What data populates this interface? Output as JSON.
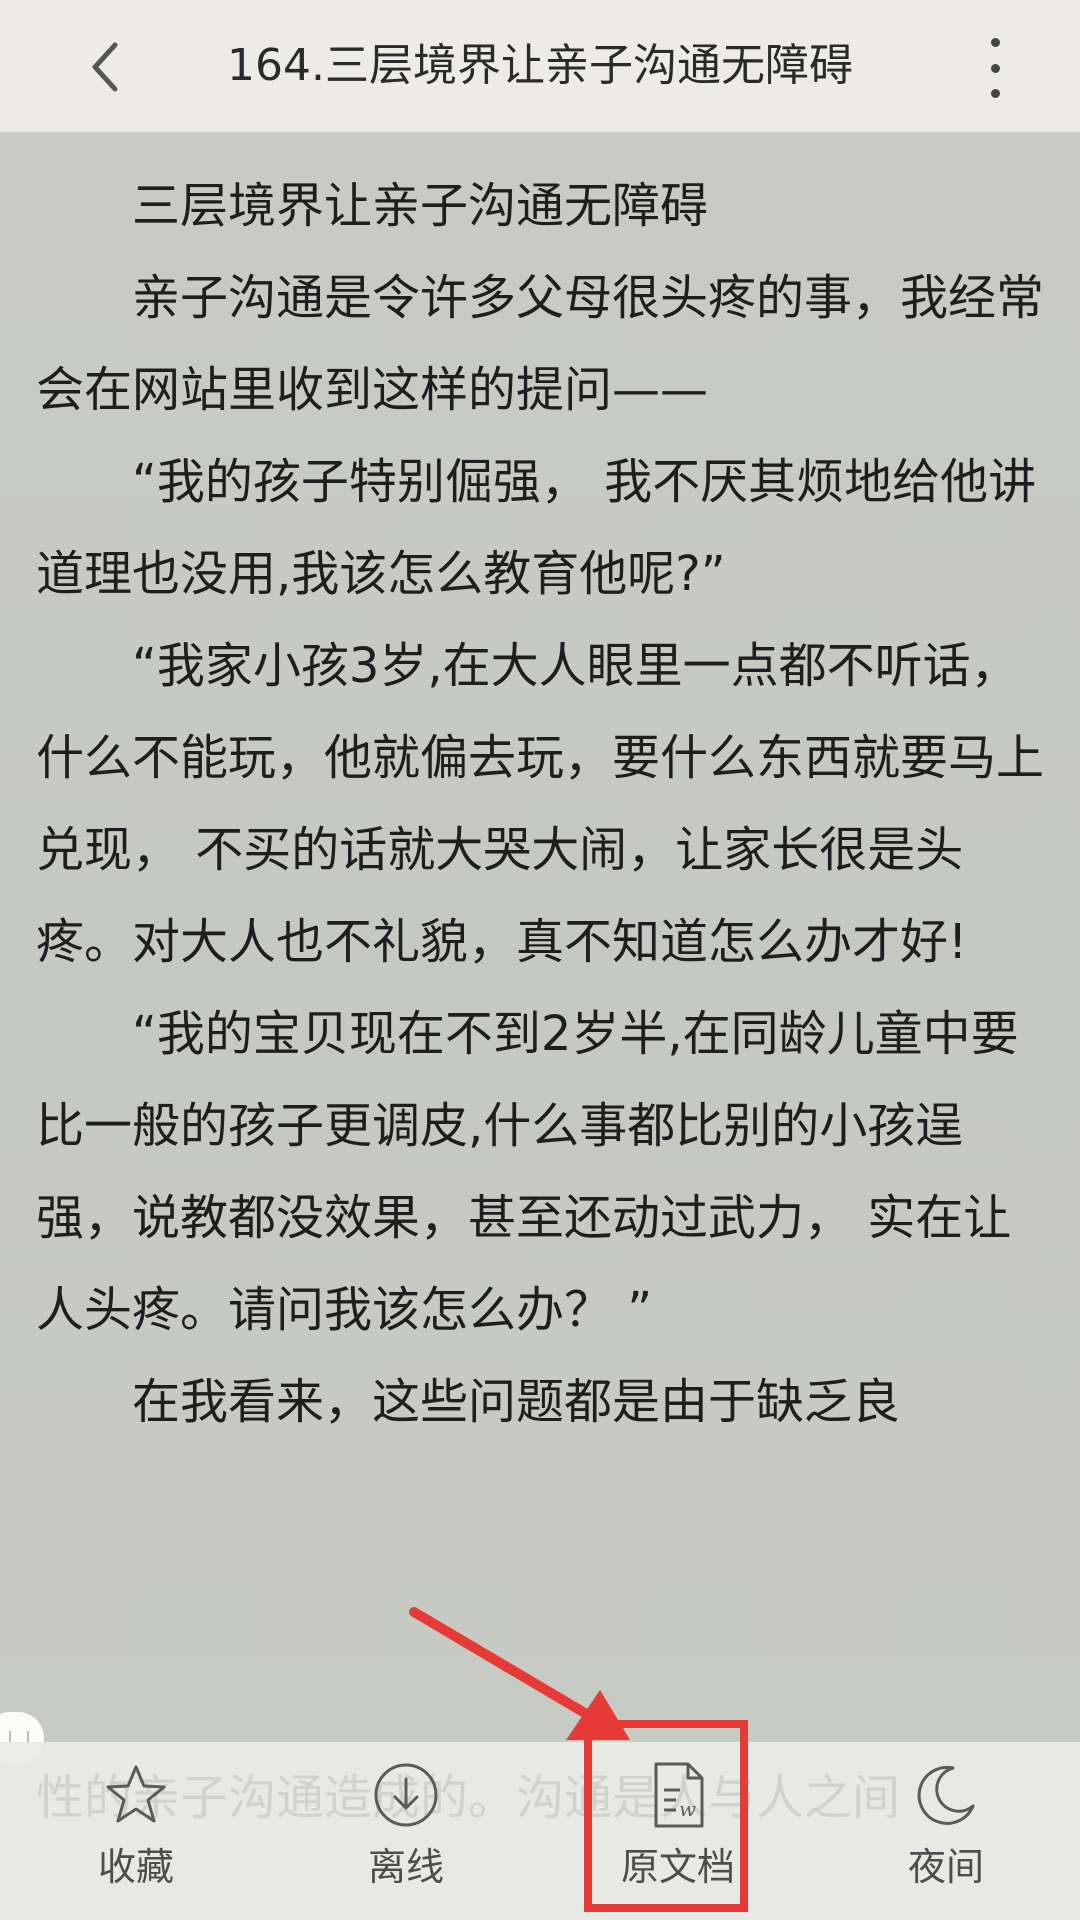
{
  "header": {
    "title": "164.三层境界让亲子沟通无障碍",
    "back_icon": "chevron-left-icon",
    "more_icon": "more-vertical-icon"
  },
  "article": {
    "heading": "三层境界让亲子沟通无障碍",
    "paragraphs": [
      "亲子沟通是令许多父母很头疼的事，我经常会在网站里收到这样的提问——",
      "“我的孩子特别倔强， 我不厌其烦地给他讲道理也没用,我该怎么教育他呢?”",
      "“我家小孩3岁,在大人眼里一点都不听话，什么不能玩，他就偏去玩，要什么东西就要马上兑现， 不买的话就大哭大闹，让家长很是头疼。对大人也不礼貌，真不知道怎么办才好!",
      "“我的宝贝现在不到2岁半,在同龄儿童中要比一般的孩子更调皮,什么事都比别的小孩逞强，说教都没效果，甚至还动过武力， 实在让人头疼。请问我该怎么办？ ”",
      "在我看来，这些问题都是由于缺乏良"
    ],
    "ghost_text": "性的亲子沟通造成的。沟通是人与人之间"
  },
  "bottom_bar": {
    "tabs": [
      {
        "label": "收藏",
        "icon": "star-icon"
      },
      {
        "label": "离线",
        "icon": "download-circle-icon"
      },
      {
        "label": "原文档",
        "icon": "word-document-icon"
      },
      {
        "label": "夜间",
        "icon": "moon-icon"
      }
    ]
  },
  "colors": {
    "background": "#c8cac4",
    "bar": "#ecebe6",
    "annotation": "#e53a36",
    "text": "#1e1e1e"
  }
}
